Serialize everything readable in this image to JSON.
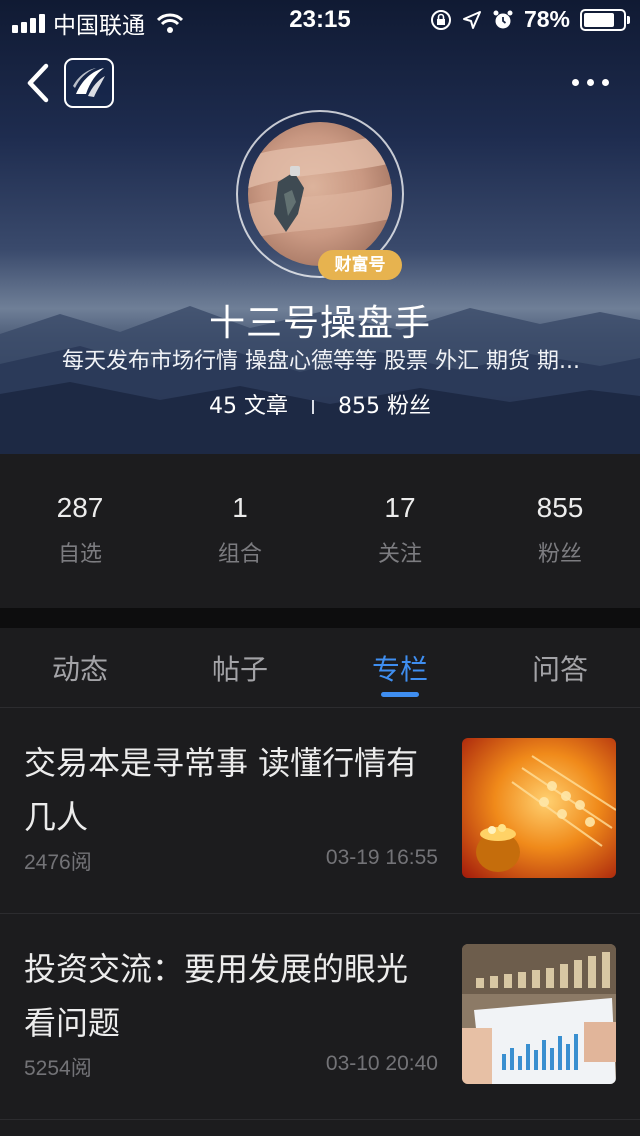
{
  "status_bar": {
    "carrier": "中国联通",
    "time": "23:15",
    "battery_percent": "78%",
    "battery_level": 0.78
  },
  "profile": {
    "badge": "财富号",
    "name": "十三号操盘手",
    "bio": "每天发布市场行情 操盘心德等等 股票 外汇 期货 期...",
    "articles_count": "45 文章",
    "fans_count": "855 粉丝"
  },
  "stats": [
    {
      "value": "287",
      "label": "自选"
    },
    {
      "value": "1",
      "label": "组合"
    },
    {
      "value": "17",
      "label": "关注"
    },
    {
      "value": "855",
      "label": "粉丝"
    }
  ],
  "tabs": [
    {
      "label": "动态",
      "active": false
    },
    {
      "label": "帖子",
      "active": false
    },
    {
      "label": "专栏",
      "active": true
    },
    {
      "label": "问答",
      "active": false
    }
  ],
  "articles": [
    {
      "title": "交易本是寻常事 读懂行情有几人",
      "reads": "2476阅",
      "date": "03-19 16:55",
      "thumb_icon": "gold-abacus-image"
    },
    {
      "title": "投资交流：要用发展的眼光看问题",
      "reads": "5254阅",
      "date": "03-10 20:40",
      "thumb_icon": "coins-chart-image"
    }
  ],
  "colors": {
    "accent": "#3f8ef0",
    "badge": "#e7b34f",
    "panel": "#1c1c1e"
  }
}
